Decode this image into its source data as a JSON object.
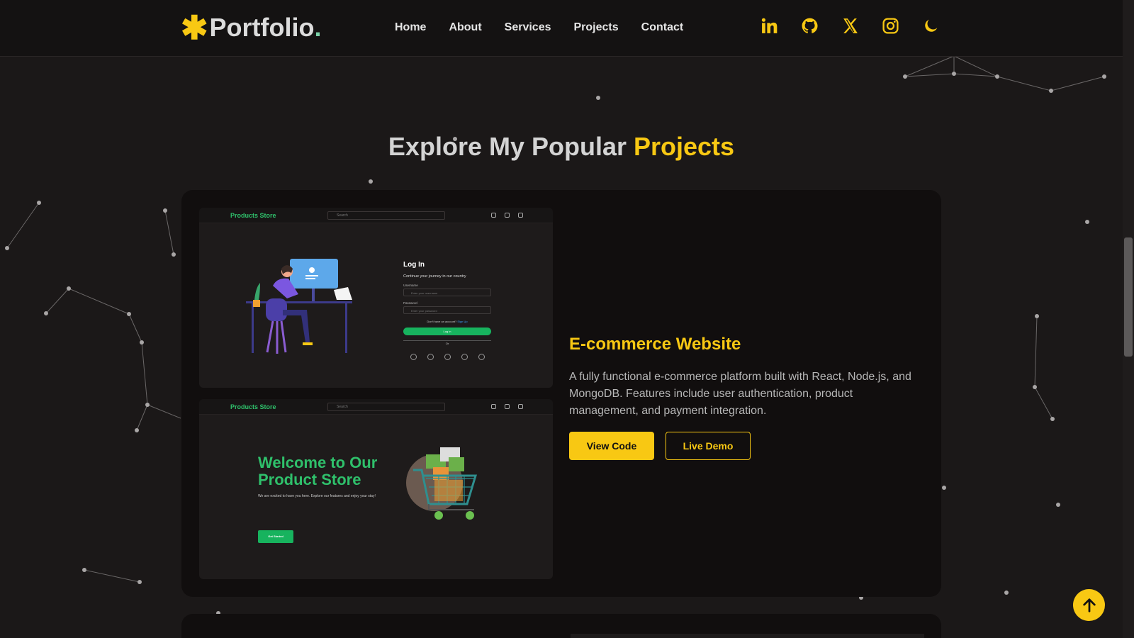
{
  "header": {
    "logo_star": "✱",
    "logo_text": "Portfolio",
    "logo_dot": ".",
    "nav": [
      "Home",
      "About",
      "Services",
      "Projects",
      "Contact"
    ],
    "socials": [
      "linkedin-icon",
      "github-icon",
      "x-icon",
      "instagram-icon",
      "moon-icon"
    ]
  },
  "section": {
    "title_main": "Explore My Popular ",
    "title_accent": "Projects"
  },
  "project": {
    "title": "E-commerce Website",
    "description": "A fully functional e-commerce platform built with React, Node.js, and MongoDB. Features include user authentication, product management, and payment integration.",
    "view_code": "View Code",
    "live_demo": "Live Demo",
    "screenshot_login": {
      "brand": "Products Store",
      "search_placeholder": "Search",
      "heading": "Log In",
      "subheading": "Continue your journey in our country",
      "username_label": "Username",
      "username_placeholder": "Enter your username",
      "password_label": "Password",
      "password_placeholder": "Enter your password",
      "signup_prompt": "Don't have an account?",
      "signup_link": "Sign Up",
      "login_button": "Log in",
      "or": "Or"
    },
    "screenshot_home": {
      "brand": "Products Store",
      "search_placeholder": "Search",
      "heading": "Welcome to Our Product Store",
      "subtext": "We are excited to have you here. Explore our features and enjoy your stay!",
      "cta": "Get Started"
    }
  },
  "colors": {
    "accent": "#f8c813",
    "background": "#1b1818",
    "card": "#110e0e",
    "store_green": "#2fc06b"
  },
  "back_to_top_icon": "arrow-up-icon"
}
